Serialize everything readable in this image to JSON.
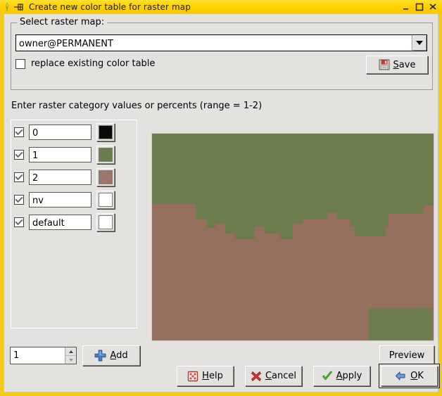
{
  "window": {
    "title": "Create new color table for raster map",
    "app_icon": "leaf-icon",
    "window_icon": "pin-icon",
    "controls": [
      {
        "name": "minimize-button",
        "glyph": "minimize-icon"
      },
      {
        "name": "maximize-button",
        "glyph": "maximize-icon"
      },
      {
        "name": "close-button",
        "glyph": "close-icon"
      }
    ]
  },
  "raster_group": {
    "title": "Select raster map:",
    "combo": {
      "value": "owner@PERMANENT",
      "placeholder": "",
      "dropdown_icon": "chevron-down-icon"
    },
    "replace_checkbox": {
      "label": "replace existing color table",
      "checked": false
    },
    "save_button": {
      "label_pre": "",
      "label_mnemonic": "S",
      "label_post": "ave",
      "icon": "floppy-disk-icon"
    }
  },
  "instruction": "Enter raster category values or percents (range = 1-2)",
  "categories": {
    "rows": [
      {
        "enabled": true,
        "value": "0",
        "color": "#0a0a0a"
      },
      {
        "enabled": true,
        "value": "1",
        "color": "#6b7c4c"
      },
      {
        "enabled": true,
        "value": "2",
        "color": "#9e776c"
      },
      {
        "enabled": true,
        "value": "nv",
        "color": "#ffffff"
      },
      {
        "enabled": true,
        "value": "default",
        "color": "#ffffff"
      }
    ]
  },
  "map_preview": {
    "name": "raster-map-preview",
    "green": "#6d7d4e",
    "brown": "#96705f"
  },
  "bottom_tools": {
    "spinner": {
      "value": "1"
    },
    "add_button": {
      "label_mnemonic": "A",
      "label_post": "dd",
      "icon": "plus-icon"
    },
    "preview_button": {
      "label": "Preview"
    }
  },
  "dialog_buttons": [
    {
      "name": "help-button",
      "mnemonic": "H",
      "post": "elp",
      "icon": "help-icon"
    },
    {
      "name": "cancel-button",
      "mnemonic": "C",
      "post": "ancel",
      "icon": "cross-icon"
    },
    {
      "name": "apply-button",
      "mnemonic": "A",
      "post": "pply",
      "icon": "check-icon"
    },
    {
      "name": "ok-button",
      "mnemonic": "O",
      "post": "K",
      "icon": "enter-arrow-icon"
    }
  ],
  "colors": {
    "titlebar": "#ffd400",
    "dialog_bg": "#e4e2de",
    "accent": "#f0cc18"
  }
}
